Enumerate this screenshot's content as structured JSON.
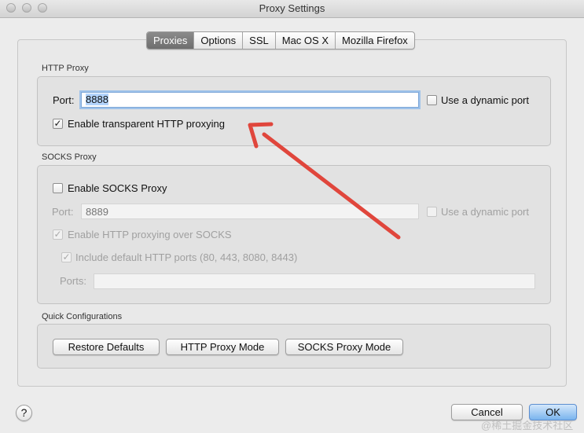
{
  "window": {
    "title": "Proxy Settings"
  },
  "tabs": [
    {
      "label": "Proxies",
      "active": true
    },
    {
      "label": "Options",
      "active": false
    },
    {
      "label": "SSL",
      "active": false
    },
    {
      "label": "Mac OS X",
      "active": false
    },
    {
      "label": "Mozilla Firefox",
      "active": false
    }
  ],
  "http_proxy": {
    "section_label": "HTTP Proxy",
    "port_label": "Port:",
    "port_value": "8888",
    "dynamic_port_label": "Use a dynamic port",
    "dynamic_port_checked": false,
    "transparent_label": "Enable transparent HTTP proxying",
    "transparent_checked": true
  },
  "socks_proxy": {
    "section_label": "SOCKS Proxy",
    "enable_label": "Enable SOCKS Proxy",
    "enable_checked": false,
    "port_label": "Port:",
    "port_placeholder": "8889",
    "dynamic_port_label": "Use a dynamic port",
    "http_over_socks_label": "Enable HTTP proxying over SOCKS",
    "http_over_socks_checked": true,
    "default_ports_label": "Include default HTTP ports (80, 443, 8080, 8443)",
    "default_ports_checked": true,
    "ports_label": "Ports:",
    "ports_value": ""
  },
  "quick_config": {
    "section_label": "Quick Configurations",
    "restore_defaults": "Restore Defaults",
    "http_proxy_mode": "HTTP Proxy Mode",
    "socks_proxy_mode": "SOCKS Proxy Mode"
  },
  "footer": {
    "help_label": "?",
    "cancel_label": "Cancel",
    "ok_label": "OK",
    "watermark": "@稀土掘金技术社区"
  },
  "colors": {
    "annotation_arrow": "#e0463c",
    "focus_ring": "#9ec2ea",
    "default_button": "#7ab4ee"
  },
  "icons": {
    "check": "✓"
  }
}
